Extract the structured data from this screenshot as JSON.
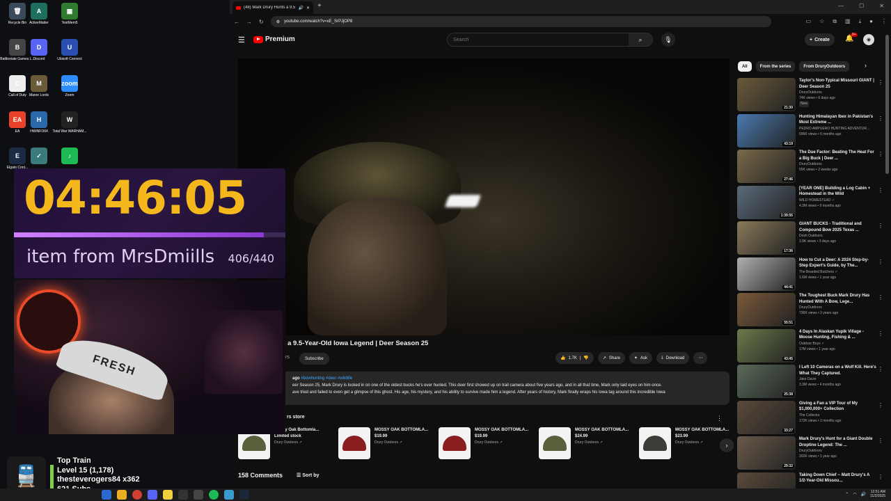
{
  "desktop": {
    "icons": [
      {
        "label": "Recycle Bin",
        "glyph": "🗑",
        "color": "#3a4a5a"
      },
      {
        "label": "ActiveMatter",
        "glyph": "A",
        "color": "#1f6f5f"
      },
      {
        "label": "TestMem5",
        "glyph": "▦",
        "color": "#2f7a2f"
      },
      {
        "label": "Battlestate Games L...",
        "glyph": "B",
        "color": "#444"
      },
      {
        "label": "Discord",
        "glyph": "D",
        "color": "#5865f2"
      },
      {
        "label": "Ubisoft Connect",
        "glyph": "U",
        "color": "#2a4fb0"
      },
      {
        "label": "Call of Duty",
        "glyph": "C",
        "color": "#eeeeee"
      },
      {
        "label": "Manor Lords",
        "glyph": "M",
        "color": "#6b5a3a"
      },
      {
        "label": "Zoom",
        "glyph": "zoom",
        "color": "#2d8cff"
      },
      {
        "label": "EA",
        "glyph": "EA",
        "color": "#e8432a"
      },
      {
        "label": "HWiNFO64",
        "glyph": "H",
        "color": "#2a6aa8"
      },
      {
        "label": "Total War WARHAM...",
        "glyph": "W",
        "color": "#222"
      },
      {
        "label": "Elgato Cont...",
        "glyph": "E",
        "color": "#1d2a44"
      },
      {
        "label": "",
        "glyph": "✓",
        "color": "#3a7a7a"
      },
      {
        "label": "",
        "glyph": "♪",
        "color": "#1db954"
      }
    ]
  },
  "browser": {
    "tab_title": "(48) Mark Drury Hunts a 9.5",
    "url": "youtube.com/watch?v=xE_SrPJjOP8"
  },
  "youtube": {
    "logo_text": "Premium",
    "search_placeholder": "Search",
    "create_label": "Create",
    "notif_count": "9+",
    "video_title": "ts a 9.5-Year-Old Iowa Legend | Deer Season 25",
    "channel_fragment": "rs",
    "subscribe_label": "Subscribe",
    "likes": "1.7K",
    "share_label": "Share",
    "ask_label": "Ask",
    "download_label": "Download",
    "desc_meta": "ago",
    "desc_tags": "#bowhunting #deer #wildlife",
    "desc_line1": "eer Season 25, Mark Drury is locked in on one of the oldest bucks he's ever hunted. This deer first showed up on trail camera about five years ago, and in all that time, Mark only laid eyes on him once.",
    "desc_line2": "ave tried and failed to even get a glimpse of this ghost. His age, his mystery, and his ability to survive made him a legend. After years of history, Mark finally wraps his Iowa tag around this incredible Iowa",
    "store_heading": "rs store",
    "products": [
      {
        "name": "Mossy Oak Bottomla...",
        "price": "Limited stock",
        "seller": "Drury Outdoors ↗",
        "style": "camo-shirt"
      },
      {
        "name": "MOSSY OAK BOTTOMLA...",
        "price": "$19.99",
        "seller": "Drury Outdoors ↗",
        "style": "red"
      },
      {
        "name": "MOSSY OAK BOTTOMLA...",
        "price": "$19.99",
        "seller": "Drury Outdoors ↗",
        "style": "red"
      },
      {
        "name": "MOSSY OAK BOTTOMLA...",
        "price": "$24.99",
        "seller": "Drury Outdoors ↗",
        "style": "camo"
      },
      {
        "name": "MOSSY OAK BOTTOMLA...",
        "price": "$23.99",
        "seller": "Drury Outdoors ↗",
        "style": "dark"
      }
    ],
    "comments_count": "158 Comments",
    "sort_label": "Sort by",
    "chips": [
      "All",
      "From the series",
      "From DruryOutdoors"
    ],
    "recommendations": [
      {
        "title": "Taylor's Non-Typical Missouri GIANT | Deer Season 25",
        "channel": "DruryOutdoors",
        "meta": "74K views • 6 days ago",
        "badge": "New",
        "duration": "21:30",
        "color": "#6a5a3a"
      },
      {
        "title": "Hunting Himalayan Ibex in Pakistan's Most Extreme ...",
        "channel": "PEDRO AMPUERO HUNTING ADVENTUR...",
        "meta": "696K views • 6 months ago",
        "badge": "",
        "duration": "43:19",
        "color": "#4a7ab0"
      },
      {
        "title": "The Due Factor: Beating The Heat For a Big Buck | Deer ...",
        "channel": "DruryOutdoors",
        "meta": "55K views • 2 weeks ago",
        "badge": "",
        "duration": "27:46",
        "color": "#7a6a4a"
      },
      {
        "title": "[YEAR ONE] Building a Log Cabin + Homestead in the Wild",
        "channel": "WILD HOMESTEAD ✓",
        "meta": "4.3M views • 9 months ago",
        "badge": "",
        "duration": "1:39:55",
        "color": "#5a6a7a"
      },
      {
        "title": "GIANT BUCKS - Traditional and Compound Bow 2025 Texas ...",
        "channel": "Dosh Outdoors",
        "meta": "3.9K views • 3 days ago",
        "badge": "",
        "duration": "17:36",
        "color": "#8a7a5a"
      },
      {
        "title": "How to Cut a Deer: A 2024 Step-by-Step Expert's Guide, by The...",
        "channel": "The Bearded Butchers ✓",
        "meta": "1.6M views • 1 year ago",
        "badge": "",
        "duration": "44:41",
        "color": "#b0b0b0"
      },
      {
        "title": "The Toughest Buck Mark Drury Has Hunted With A Bow, Lege...",
        "channel": "DruryOutdoors",
        "meta": "736K views • 3 years ago",
        "badge": "",
        "duration": "55:51",
        "color": "#7a5a3a"
      },
      {
        "title": "4 Days In Alaskan Yupik Village - Moose Hunting, Fishing & ...",
        "channel": "Outdoor Boys ✓",
        "meta": "17M views • 1 year ago",
        "badge": "",
        "duration": "43:45",
        "color": "#6a7a4a"
      },
      {
        "title": "I Left 10 Cameras on a Wolf Kill. Here's What They Captured.",
        "channel": "Jake Davis",
        "meta": "3.3M views • 4 months ago",
        "badge": "",
        "duration": "25:38",
        "color": "#5a6a5a"
      },
      {
        "title": "Giving a Fan a VIP Tour of My $1,000,000+ Collection",
        "channel": "The Collector",
        "meta": "172K views • 2 months ago",
        "badge": "",
        "duration": "33:27",
        "color": "#5a4a3a"
      },
      {
        "title": "Mark Drury's Hunt for a Giant Double Droptine Legend: The ...",
        "channel": "DruryOutdoors",
        "meta": "202K views • 1 year ago",
        "badge": "",
        "duration": "29:32",
        "color": "#6a5a4a"
      },
      {
        "title": "Taking Down Chief -- Matt Drury's A 1/2-Year-Old Missou...",
        "channel": "",
        "meta": "",
        "badge": "",
        "duration": "",
        "color": "#5a4a3a"
      }
    ]
  },
  "overlay": {
    "timer": "04:46:05",
    "goal_text": "item from MrsDmiills",
    "goal_count": "406/440",
    "goal_progress": 0.92,
    "cap_text": "FRESH",
    "train_title": "Top Train",
    "train_level": "Level 15  (1,178)",
    "train_user": "thesteverogers84 x362",
    "train_subs": "621 Subs"
  },
  "taskbar": {
    "time": "12:51 AM",
    "date": "11/2/2025"
  }
}
